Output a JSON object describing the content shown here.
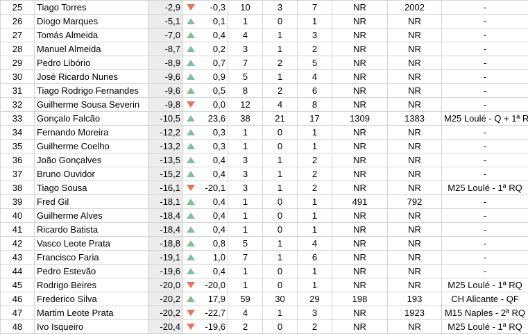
{
  "colors": {
    "up": "#7fbf9a",
    "down": "#e8735a",
    "diff_bg": "#ececec"
  },
  "rows": [
    {
      "rank": "25",
      "name": "Tiago Torres",
      "diff": "-2,9",
      "trend": "down",
      "delta": "-0,3",
      "a": "10",
      "b": "3",
      "c": "7",
      "r1": "NR",
      "r2": "2002",
      "result": "-"
    },
    {
      "rank": "26",
      "name": "Diogo Marques",
      "diff": "-5,1",
      "trend": "up",
      "delta": "0,1",
      "a": "1",
      "b": "0",
      "c": "1",
      "r1": "NR",
      "r2": "NR",
      "result": "-"
    },
    {
      "rank": "27",
      "name": "Tomás Almeida",
      "diff": "-7,0",
      "trend": "up",
      "delta": "0,4",
      "a": "4",
      "b": "1",
      "c": "3",
      "r1": "NR",
      "r2": "NR",
      "result": "-"
    },
    {
      "rank": "28",
      "name": "Manuel Almeida",
      "diff": "-8,7",
      "trend": "up",
      "delta": "0,2",
      "a": "3",
      "b": "1",
      "c": "2",
      "r1": "NR",
      "r2": "NR",
      "result": "-"
    },
    {
      "rank": "29",
      "name": "Pedro Libório",
      "diff": "-8,9",
      "trend": "up",
      "delta": "0,7",
      "a": "7",
      "b": "2",
      "c": "5",
      "r1": "NR",
      "r2": "NR",
      "result": "-"
    },
    {
      "rank": "30",
      "name": "José Ricardo Nunes",
      "diff": "-9,6",
      "trend": "up",
      "delta": "0,9",
      "a": "5",
      "b": "1",
      "c": "4",
      "r1": "NR",
      "r2": "NR",
      "result": "-"
    },
    {
      "rank": "31",
      "name": "Tiago Rodrigo Fernandes",
      "diff": "-9,6",
      "trend": "up",
      "delta": "0,5",
      "a": "8",
      "b": "2",
      "c": "6",
      "r1": "NR",
      "r2": "NR",
      "result": "-"
    },
    {
      "rank": "32",
      "name": "Guilherme Sousa Severin",
      "diff": "-9,8",
      "trend": "down",
      "delta": "0,0",
      "a": "12",
      "b": "4",
      "c": "8",
      "r1": "NR",
      "r2": "NR",
      "result": "-"
    },
    {
      "rank": "33",
      "name": "Gonçalo Falcão",
      "diff": "-10,5",
      "trend": "up",
      "delta": "23,6",
      "a": "38",
      "b": "21",
      "c": "17",
      "r1": "1309",
      "r2": "1383",
      "result": "M25 Loulé - Q + 1ª R"
    },
    {
      "rank": "34",
      "name": "Fernando Moreira",
      "diff": "-12,2",
      "trend": "up",
      "delta": "0,3",
      "a": "1",
      "b": "0",
      "c": "1",
      "r1": "NR",
      "r2": "NR",
      "result": "-"
    },
    {
      "rank": "35",
      "name": "Guilherme Coelho",
      "diff": "-13,2",
      "trend": "up",
      "delta": "0,3",
      "a": "1",
      "b": "0",
      "c": "1",
      "r1": "NR",
      "r2": "NR",
      "result": "-"
    },
    {
      "rank": "36",
      "name": "João Gonçalves",
      "diff": "-13,5",
      "trend": "up",
      "delta": "0,4",
      "a": "3",
      "b": "1",
      "c": "2",
      "r1": "NR",
      "r2": "NR",
      "result": "-"
    },
    {
      "rank": "37",
      "name": "Bruno Ouvidor",
      "diff": "-15,2",
      "trend": "up",
      "delta": "0,4",
      "a": "3",
      "b": "1",
      "c": "2",
      "r1": "NR",
      "r2": "NR",
      "result": "-"
    },
    {
      "rank": "38",
      "name": "Tiago Sousa",
      "diff": "-16,1",
      "trend": "down",
      "delta": "-20,1",
      "a": "3",
      "b": "1",
      "c": "2",
      "r1": "NR",
      "r2": "NR",
      "result": "M25 Loulé - 1ª RQ"
    },
    {
      "rank": "39",
      "name": "Fred Gil",
      "diff": "-18,1",
      "trend": "up",
      "delta": "0,4",
      "a": "1",
      "b": "0",
      "c": "1",
      "r1": "491",
      "r2": "792",
      "result": "-"
    },
    {
      "rank": "40",
      "name": "Guilherme Alves",
      "diff": "-18,4",
      "trend": "up",
      "delta": "0,4",
      "a": "1",
      "b": "0",
      "c": "1",
      "r1": "NR",
      "r2": "NR",
      "result": "-"
    },
    {
      "rank": "41",
      "name": "Ricardo Batista",
      "diff": "-18,4",
      "trend": "up",
      "delta": "0,4",
      "a": "1",
      "b": "0",
      "c": "1",
      "r1": "NR",
      "r2": "NR",
      "result": "-"
    },
    {
      "rank": "42",
      "name": "Vasco Leote Prata",
      "diff": "-18,8",
      "trend": "up",
      "delta": "0,8",
      "a": "5",
      "b": "1",
      "c": "4",
      "r1": "NR",
      "r2": "NR",
      "result": "-"
    },
    {
      "rank": "43",
      "name": "Francisco Faria",
      "diff": "-19,1",
      "trend": "up",
      "delta": "1,0",
      "a": "7",
      "b": "1",
      "c": "6",
      "r1": "NR",
      "r2": "NR",
      "result": "-"
    },
    {
      "rank": "44",
      "name": "Pedro Estevão",
      "diff": "-19,6",
      "trend": "up",
      "delta": "0,4",
      "a": "1",
      "b": "0",
      "c": "1",
      "r1": "NR",
      "r2": "NR",
      "result": "-"
    },
    {
      "rank": "45",
      "name": "Rodrigo Beires",
      "diff": "-20,0",
      "trend": "down",
      "delta": "-20,0",
      "a": "1",
      "b": "0",
      "c": "1",
      "r1": "NR",
      "r2": "NR",
      "result": "M25 Loulé - 1ª RQ"
    },
    {
      "rank": "46",
      "name": "Frederico Silva",
      "diff": "-20,2",
      "trend": "up",
      "delta": "17,9",
      "a": "59",
      "b": "30",
      "c": "29",
      "r1": "198",
      "r2": "193",
      "result": "CH Alicante - QF"
    },
    {
      "rank": "47",
      "name": "Martim Leote Prata",
      "diff": "-20,2",
      "trend": "down",
      "delta": "-22,7",
      "a": "4",
      "b": "1",
      "c": "3",
      "r1": "NR",
      "r2": "1923",
      "result": "M15 Naples - 2ª RQ"
    },
    {
      "rank": "48",
      "name": "Ivo Isqueiro",
      "diff": "-20,4",
      "trend": "down",
      "delta": "-19,6",
      "a": "2",
      "b": "0",
      "c": "2",
      "r1": "NR",
      "r2": "NR",
      "result": "M25 Loulé - 1ª RQ"
    }
  ]
}
